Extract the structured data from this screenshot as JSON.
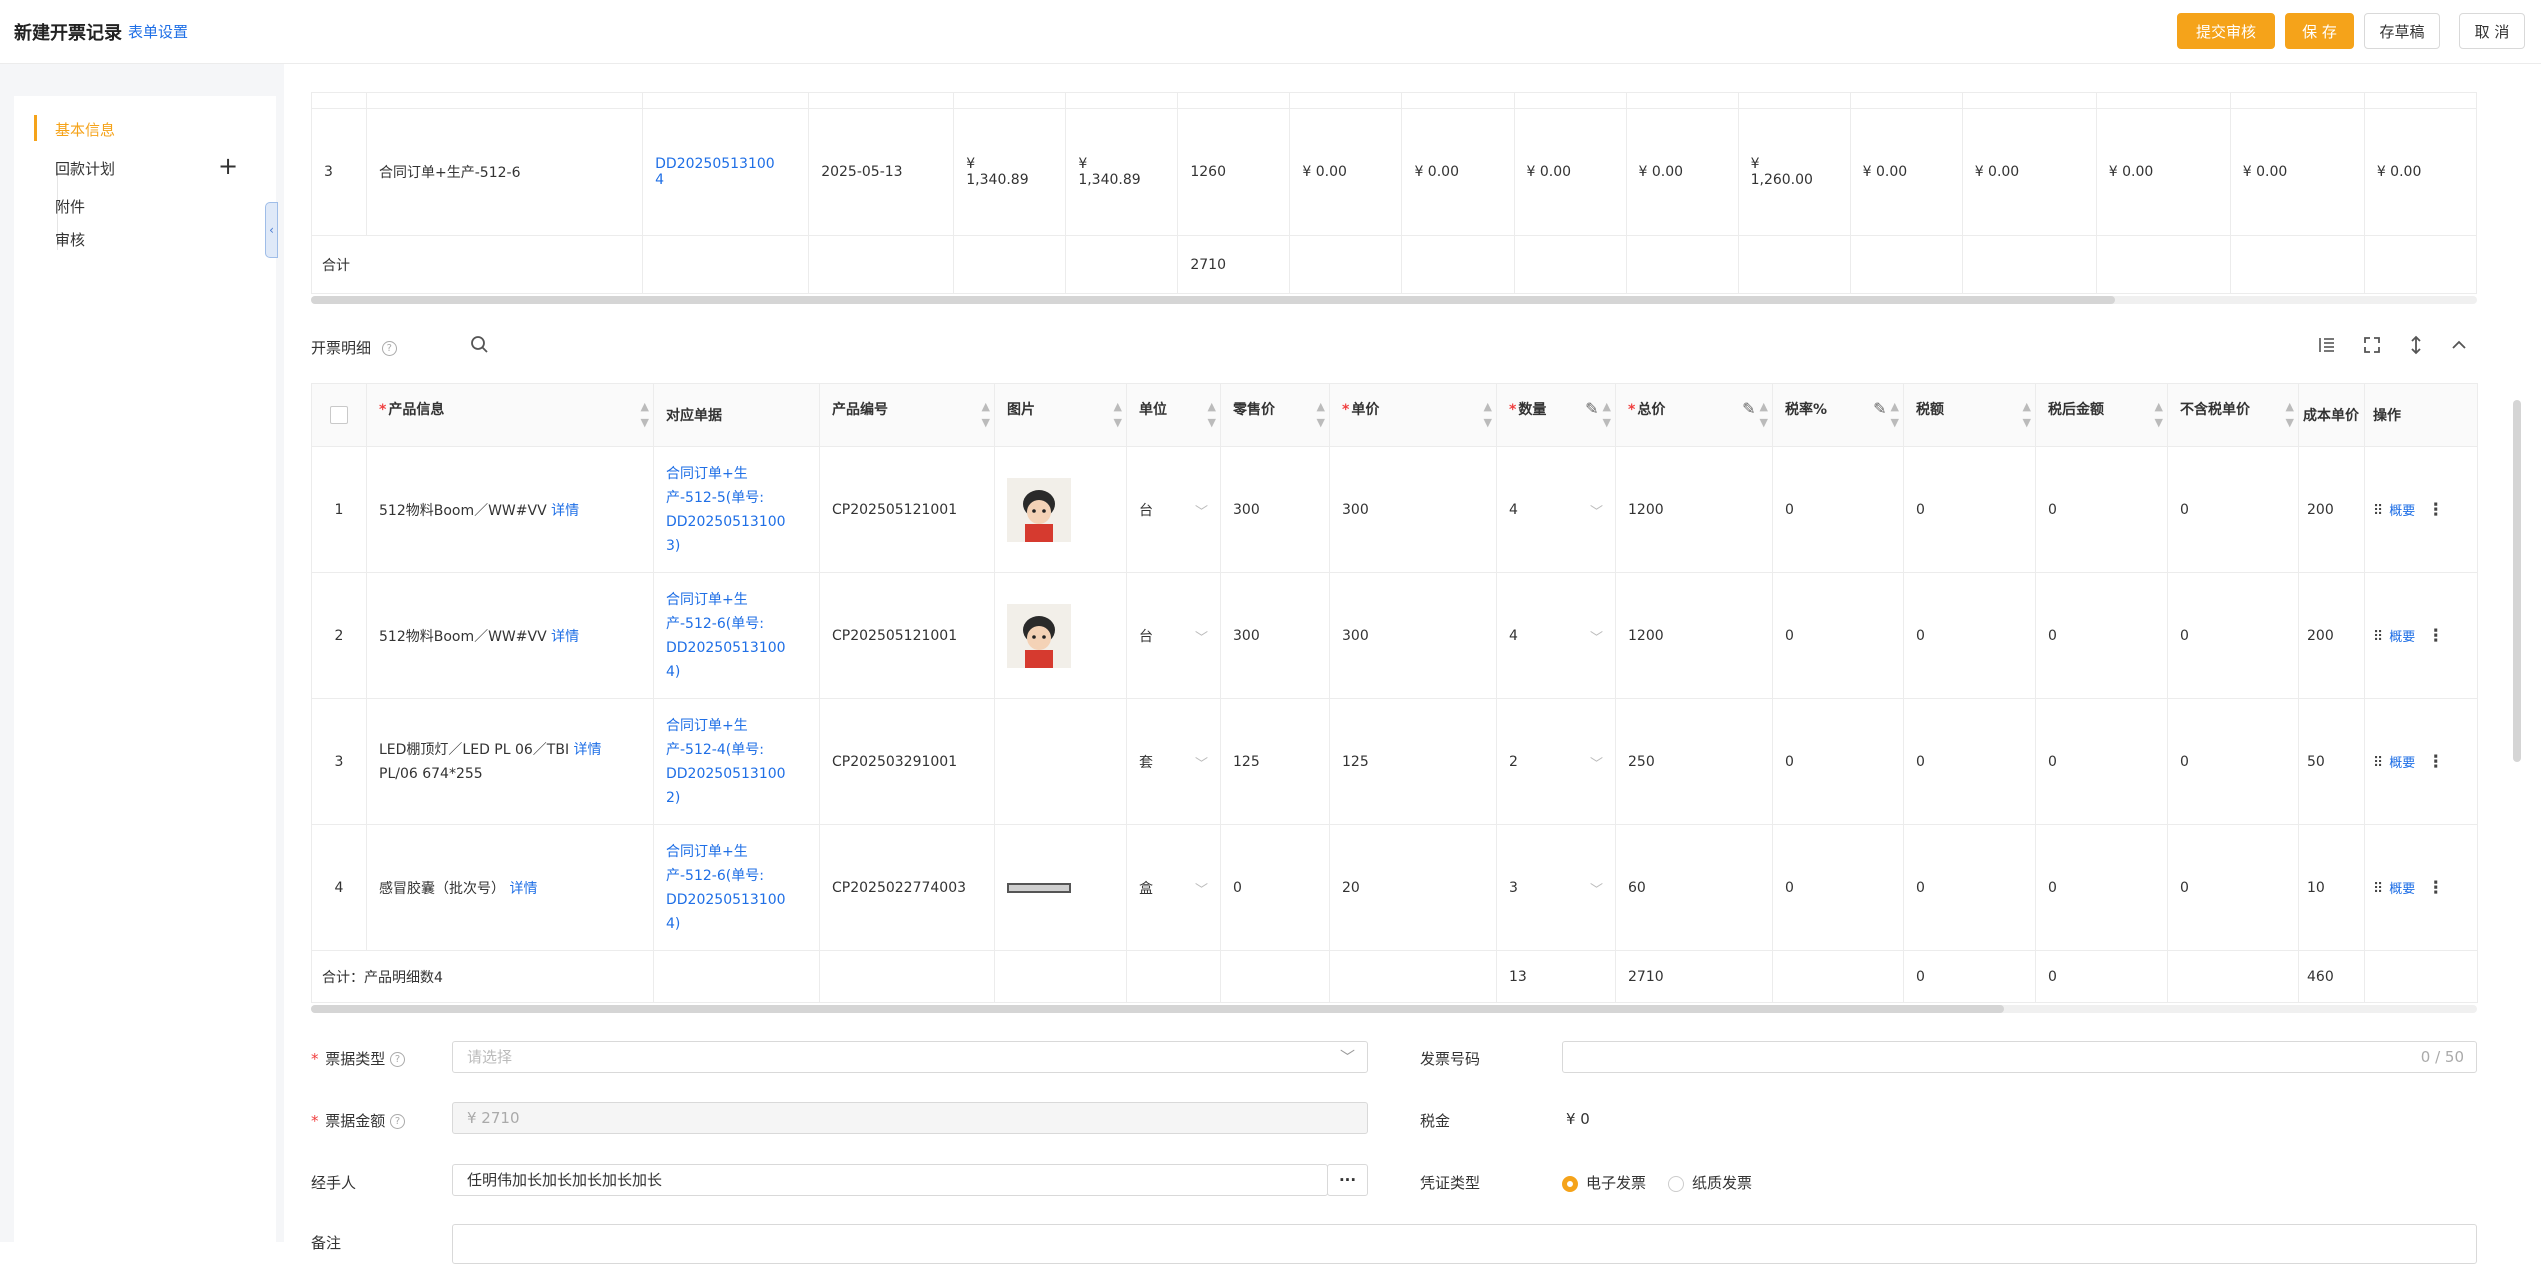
{
  "header": {
    "title": "新建开票记录",
    "form_settings": "表单设置",
    "buttons": {
      "submit": "提交审核",
      "save": "保 存",
      "draft": "存草稿",
      "cancel": "取 消"
    }
  },
  "sidebar": {
    "items": [
      {
        "label": "基本信息",
        "active": true
      },
      {
        "label": "回款计划"
      },
      {
        "label": "附件"
      },
      {
        "label": "审核"
      }
    ],
    "add_symbol": "+",
    "collapse_symbol": "‹"
  },
  "orders_table": {
    "row": {
      "index": "3",
      "name": "合同订单+生产-512-6",
      "order_no_line1": "DD20250513100",
      "order_no_line2": "4",
      "date": "2025-05-13",
      "amount1_line1": "¥",
      "amount1_line2": "1,340.89",
      "amount2_line1": "¥",
      "amount2_line2": "1,340.89",
      "qty": "1260",
      "c1": "¥ 0.00",
      "c2": "¥ 0.00",
      "c3": "¥ 0.00",
      "c4": "¥ 0.00",
      "c5_line1": "¥",
      "c5_line2": "1,260.00",
      "c6": "¥ 0.00",
      "c7": "¥ 0.00",
      "c8": "¥ 0.00",
      "c9": "¥ 0.00",
      "c10": "¥ 0.00"
    },
    "total": {
      "label": "合计",
      "qty": "2710"
    }
  },
  "detail_section": {
    "title": "开票明细"
  },
  "detail_table": {
    "headers": {
      "product": "产品信息",
      "doc": "对应单据",
      "code": "产品编号",
      "image": "图片",
      "unit": "单位",
      "retail": "零售价",
      "price": "单价",
      "qty": "数量",
      "total": "总价",
      "tax_rate": "税率%",
      "tax": "税额",
      "after_tax": "税后金额",
      "no_tax_price": "不含税单价",
      "cost": "成本单价",
      "ops": "操作"
    },
    "detail_link": "详情",
    "overview_link": "概要",
    "rows": [
      {
        "index": "1",
        "product": "512物料Boom／WW#VV",
        "product_line2": "",
        "doc_lines": [
          "合同订单+生",
          "产-512-5(单号:",
          "DD20250513100",
          "3)"
        ],
        "code": "CP202505121001",
        "image": "face",
        "unit": "台",
        "retail": "300",
        "price": "300",
        "qty": "4",
        "total": "1200",
        "tax_rate": "0",
        "tax": "0",
        "after_tax": "0",
        "no_tax_price": "0",
        "cost": "200"
      },
      {
        "index": "2",
        "product": "512物料Boom／WW#VV",
        "product_line2": "",
        "doc_lines": [
          "合同订单+生",
          "产-512-6(单号:",
          "DD20250513100",
          "4)"
        ],
        "code": "CP202505121001",
        "image": "face",
        "unit": "台",
        "retail": "300",
        "price": "300",
        "qty": "4",
        "total": "1200",
        "tax_rate": "0",
        "tax": "0",
        "after_tax": "0",
        "no_tax_price": "0",
        "cost": "200"
      },
      {
        "index": "3",
        "product": "LED棚顶灯／LED PL 06／TBI",
        "product_line2": "PL/06 674*255",
        "doc_lines": [
          "合同订单+生",
          "产-512-4(单号:",
          "DD20250513100",
          "2)"
        ],
        "code": "CP202503291001",
        "image": "none",
        "unit": "套",
        "retail": "125",
        "price": "125",
        "qty": "2",
        "total": "250",
        "tax_rate": "0",
        "tax": "0",
        "after_tax": "0",
        "no_tax_price": "0",
        "cost": "50"
      },
      {
        "index": "4",
        "product": "感冒胶囊（批次号）",
        "product_line2": "",
        "doc_lines": [
          "合同订单+生",
          "产-512-6(单号:",
          "DD20250513100",
          "4)"
        ],
        "code": "CP2025022774003",
        "image": "bar",
        "unit": "盒",
        "retail": "0",
        "price": "20",
        "qty": "3",
        "total": "60",
        "tax_rate": "0",
        "tax": "0",
        "after_tax": "0",
        "no_tax_price": "0",
        "cost": "10"
      }
    ],
    "total": {
      "label": "合计：产品明细数4",
      "qty": "13",
      "total": "2710",
      "tax": "0",
      "after_tax": "0",
      "cost": "460"
    }
  },
  "form": {
    "invoice_type": {
      "label": "票据类型",
      "placeholder": "请选择"
    },
    "invoice_no": {
      "label": "发票号码",
      "counter": "0 / 50"
    },
    "invoice_amount": {
      "label": "票据金额",
      "value": "¥  2710"
    },
    "tax": {
      "label": "税金",
      "value": "¥ 0"
    },
    "handler": {
      "label": "经手人",
      "value": "任明伟加长加长加长加长加长",
      "more": "···"
    },
    "voucher_type": {
      "label": "凭证类型",
      "options": [
        "电子发票",
        "纸质发票"
      ],
      "selected": "电子发票"
    },
    "remark": {
      "label": "备注"
    }
  },
  "colors": {
    "accent": "#f5a31a",
    "link": "#1f6fe6",
    "required": "#f04040"
  }
}
